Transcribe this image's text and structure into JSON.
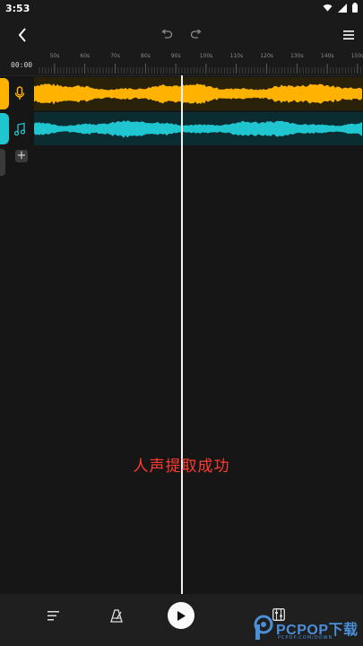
{
  "status_bar": {
    "time": "3:53"
  },
  "timeline": {
    "timecode": "00:00",
    "tick_labels": [
      "50s",
      "60s",
      "70s",
      "80s",
      "90s",
      "100s",
      "110s",
      "120s",
      "130s",
      "140s",
      "150s"
    ]
  },
  "tracks": [
    {
      "name": "vocal",
      "icon": "microphone-icon",
      "color": "#ffb300"
    },
    {
      "name": "music",
      "icon": "music-note-icon",
      "color": "#1fc6d0"
    }
  ],
  "toast": {
    "message": "人声提取成功"
  },
  "watermark": {
    "text": "PCPOP下载",
    "subtext": "PCPOP.COM/DOWN"
  },
  "colors": {
    "background": "#161616",
    "vocal_wave": "#ffb300",
    "music_wave": "#1fc6d0",
    "toast": "#ff3b30"
  }
}
